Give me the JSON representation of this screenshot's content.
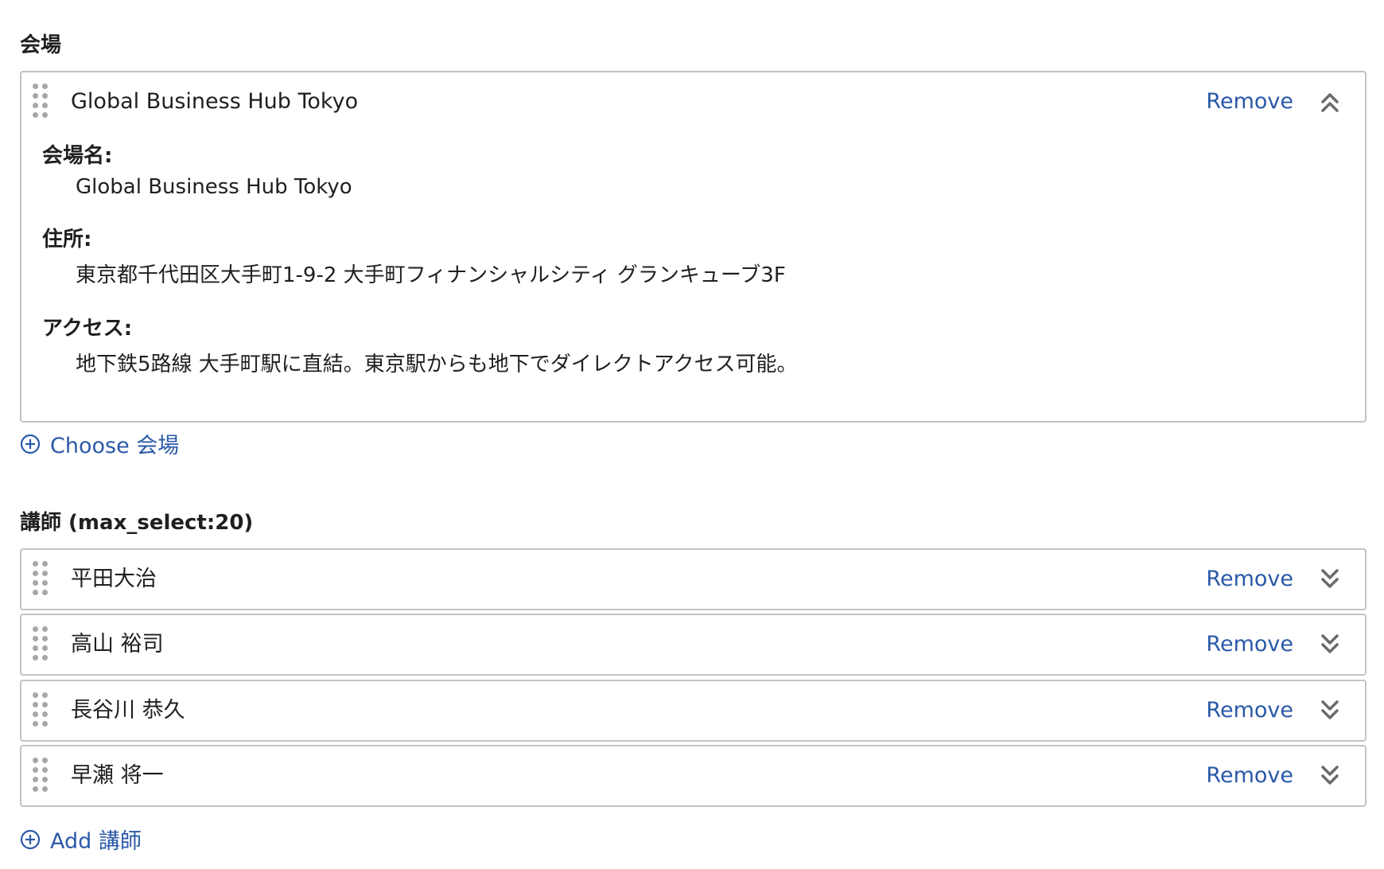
{
  "venue_section": {
    "label": "会場",
    "card": {
      "title": "Global Business Hub Tokyo",
      "remove_label": "Remove",
      "toggle_icon": "chevron-double-up-icon",
      "fields": [
        {
          "label": "会場名:",
          "value": "Global Business Hub Tokyo"
        },
        {
          "label": "住所:",
          "value": "東京都千代田区大手町1-9-2 大手町フィナンシャルシティ グランキューブ3F"
        },
        {
          "label": "アクセス:",
          "value": "地下鉄5路線 大手町駅に直結。東京駅からも地下でダイレクトアクセス可能。"
        }
      ]
    },
    "choose_label": "Choose 会場",
    "choose_icon": "plus-circle-icon"
  },
  "instructor_section": {
    "label": "講師 (max_select:20)",
    "items": [
      {
        "name": "平田大治",
        "remove_label": "Remove",
        "toggle_icon": "chevron-double-down-icon"
      },
      {
        "name": "高山 裕司",
        "remove_label": "Remove",
        "toggle_icon": "chevron-double-down-icon"
      },
      {
        "name": "長谷川 恭久",
        "remove_label": "Remove",
        "toggle_icon": "chevron-double-down-icon"
      },
      {
        "name": "早瀬 将一",
        "remove_label": "Remove",
        "toggle_icon": "chevron-double-down-icon"
      }
    ],
    "add_label": "Add 講師",
    "add_icon": "plus-circle-icon"
  },
  "colors": {
    "link": "#2a59a8",
    "border": "#c3c3c3",
    "text": "#1f1f1f",
    "handle": "#a7a7a7"
  }
}
